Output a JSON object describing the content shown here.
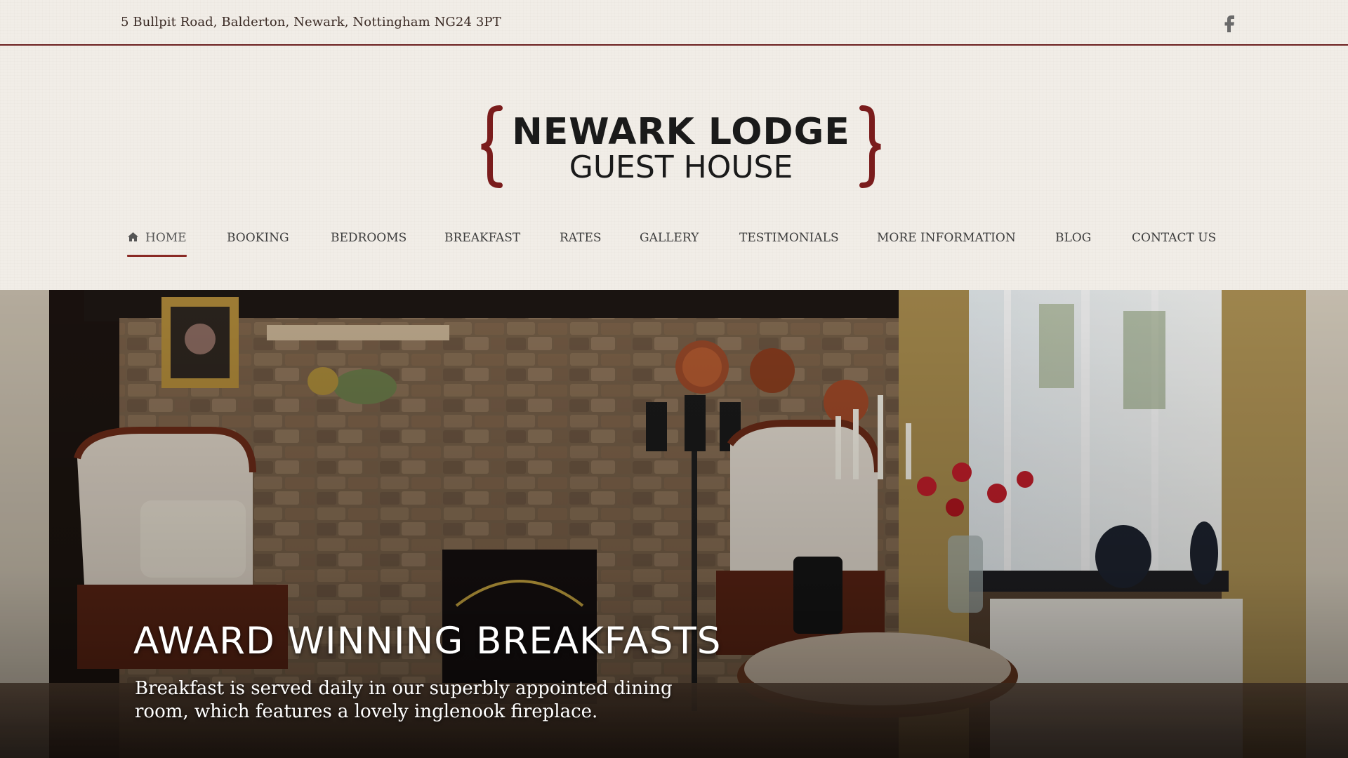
{
  "topbar": {
    "address": "5 Bullpit Road, Balderton, Newark, Nottingham NG24 3PT",
    "social_icon": "facebook-icon"
  },
  "logo": {
    "line1": "NEWARK LODGE",
    "line2": "GUEST HOUSE"
  },
  "nav": {
    "items": [
      {
        "label": "HOME",
        "active": true,
        "icon": "home-icon"
      },
      {
        "label": "BOOKING"
      },
      {
        "label": "BEDROOMS"
      },
      {
        "label": "BREAKFAST"
      },
      {
        "label": "RATES"
      },
      {
        "label": "GALLERY"
      },
      {
        "label": "TESTIMONIALS"
      },
      {
        "label": "MORE INFORMATION"
      },
      {
        "label": "BLOG"
      },
      {
        "label": "CONTACT US"
      }
    ]
  },
  "hero": {
    "headline": "AWARD WINNING BREAKFASTS",
    "subtext": "Breakfast is served daily in our superbly appointed dining room, which features a lovely inglenook fireplace."
  },
  "colors": {
    "accent": "#7a1c1c",
    "background": "#f1ede7",
    "text": "#3c3c3c"
  }
}
